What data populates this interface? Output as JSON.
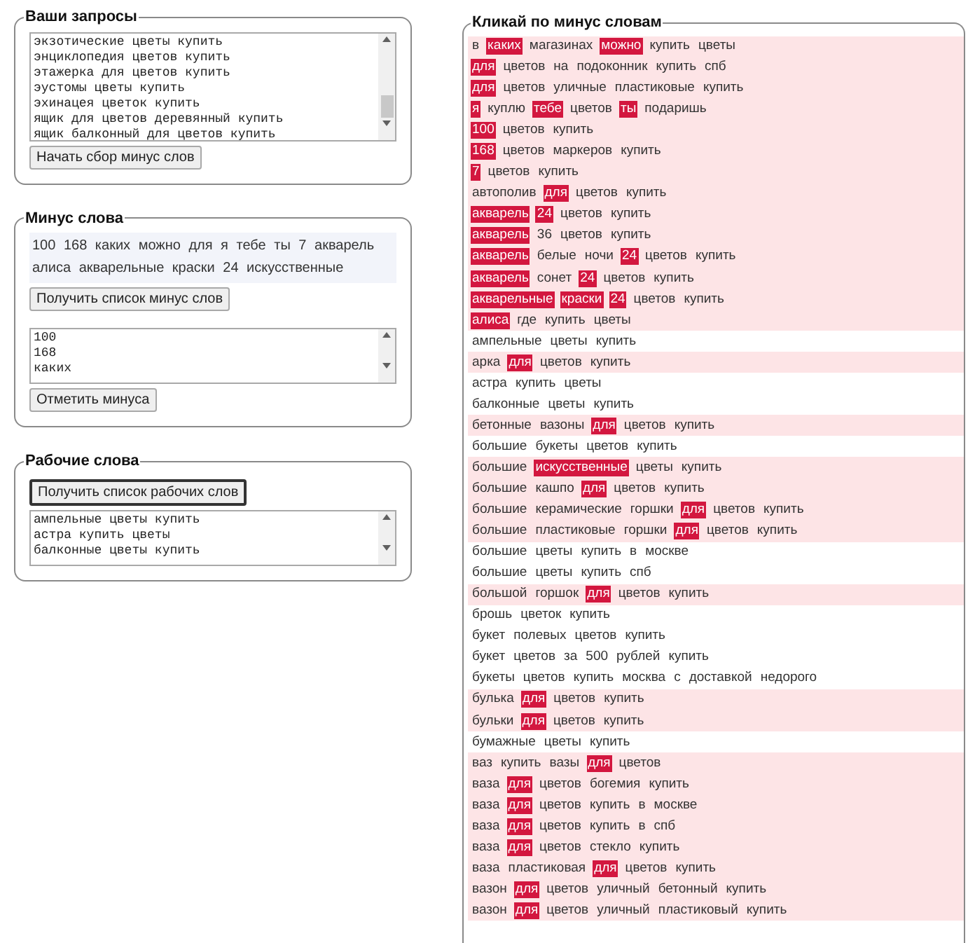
{
  "queries": {
    "title": "Ваши запросы",
    "lines": [
      "экзотические цветы купить",
      "энциклопедия цветов купить",
      "этажерка для цветов купить",
      "эустомы цветы купить",
      "эхинацея цветок купить",
      "ящик для цветов деревянный купить",
      "ящик балконный для цветов купить"
    ],
    "button": "Начать сбор минус слов"
  },
  "minus": {
    "title": "Минус слова",
    "summary": "100 168 каких можно для я тебе ты 7 акварель алиса акварельные краски 24 искусственные",
    "get_button": "Получить список минус слов",
    "lines": [
      "100",
      "168",
      "каких"
    ],
    "mark_button": "Отметить минуса"
  },
  "working": {
    "title": "Рабочие слова",
    "button": "Получить список рабочих слов",
    "lines": [
      "ампельные цветы купить",
      "астра купить цветы",
      "балконные цветы купить"
    ]
  },
  "results": {
    "title": "Кликай по минус словам",
    "rows": [
      {
        "words": [
          {
            "text": "в",
            "minus": false
          },
          {
            "text": "каких",
            "minus": true
          },
          {
            "text": "магазинах",
            "minus": false
          },
          {
            "text": "можно",
            "minus": true
          },
          {
            "text": "купить",
            "minus": false
          },
          {
            "text": "цветы",
            "minus": false
          }
        ]
      },
      {
        "words": [
          {
            "text": "для",
            "minus": true
          },
          {
            "text": "цветов",
            "minus": false
          },
          {
            "text": "на",
            "minus": false
          },
          {
            "text": "подоконник",
            "minus": false
          },
          {
            "text": "купить",
            "minus": false
          },
          {
            "text": "спб",
            "minus": false
          }
        ]
      },
      {
        "words": [
          {
            "text": "для",
            "minus": true
          },
          {
            "text": "цветов",
            "minus": false
          },
          {
            "text": "уличные",
            "minus": false
          },
          {
            "text": "пластиковые",
            "minus": false
          },
          {
            "text": "купить",
            "minus": false
          }
        ]
      },
      {
        "words": [
          {
            "text": "я",
            "minus": true
          },
          {
            "text": "куплю",
            "minus": false
          },
          {
            "text": "тебе",
            "minus": true
          },
          {
            "text": "цветов",
            "minus": false
          },
          {
            "text": "ты",
            "minus": true
          },
          {
            "text": "подаришь",
            "minus": false
          }
        ]
      },
      {
        "words": [
          {
            "text": "100",
            "minus": true
          },
          {
            "text": "цветов",
            "minus": false
          },
          {
            "text": "купить",
            "minus": false
          }
        ]
      },
      {
        "words": [
          {
            "text": "168",
            "minus": true
          },
          {
            "text": "цветов",
            "minus": false
          },
          {
            "text": "маркеров",
            "minus": false
          },
          {
            "text": "купить",
            "minus": false
          }
        ]
      },
      {
        "words": [
          {
            "text": "7",
            "minus": true
          },
          {
            "text": "цветов",
            "minus": false
          },
          {
            "text": "купить",
            "minus": false
          }
        ]
      },
      {
        "words": [
          {
            "text": "автополив",
            "minus": false
          },
          {
            "text": "для",
            "minus": true
          },
          {
            "text": "цветов",
            "minus": false
          },
          {
            "text": "купить",
            "minus": false
          }
        ]
      },
      {
        "words": [
          {
            "text": "акварель",
            "minus": true
          },
          {
            "text": "24",
            "minus": true
          },
          {
            "text": "цветов",
            "minus": false
          },
          {
            "text": "купить",
            "minus": false
          }
        ]
      },
      {
        "words": [
          {
            "text": "акварель",
            "minus": true
          },
          {
            "text": "36",
            "minus": false
          },
          {
            "text": "цветов",
            "minus": false
          },
          {
            "text": "купить",
            "minus": false
          }
        ]
      },
      {
        "words": [
          {
            "text": "акварель",
            "minus": true
          },
          {
            "text": "белые",
            "minus": false
          },
          {
            "text": "ночи",
            "minus": false
          },
          {
            "text": "24",
            "minus": true
          },
          {
            "text": "цветов",
            "minus": false
          },
          {
            "text": "купить",
            "minus": false
          }
        ]
      },
      {
        "words": [
          {
            "text": "акварель",
            "minus": true
          },
          {
            "text": "сонет",
            "minus": false
          },
          {
            "text": "24",
            "minus": true
          },
          {
            "text": "цветов",
            "minus": false
          },
          {
            "text": "купить",
            "minus": false
          }
        ]
      },
      {
        "words": [
          {
            "text": "акварельные",
            "minus": true
          },
          {
            "text": "краски",
            "minus": true
          },
          {
            "text": "24",
            "minus": true
          },
          {
            "text": "цветов",
            "minus": false
          },
          {
            "text": "купить",
            "minus": false
          }
        ]
      },
      {
        "words": [
          {
            "text": "алиса",
            "minus": true
          },
          {
            "text": "где",
            "minus": false
          },
          {
            "text": "купить",
            "minus": false
          },
          {
            "text": "цветы",
            "minus": false
          }
        ]
      },
      {
        "words": [
          {
            "text": "ампельные",
            "minus": false
          },
          {
            "text": "цветы",
            "minus": false
          },
          {
            "text": "купить",
            "minus": false
          }
        ]
      },
      {
        "words": [
          {
            "text": "арка",
            "minus": false
          },
          {
            "text": "для",
            "minus": true
          },
          {
            "text": "цветов",
            "minus": false
          },
          {
            "text": "купить",
            "minus": false
          }
        ]
      },
      {
        "words": [
          {
            "text": "астра",
            "minus": false
          },
          {
            "text": "купить",
            "minus": false
          },
          {
            "text": "цветы",
            "minus": false
          }
        ]
      },
      {
        "words": [
          {
            "text": "балконные",
            "minus": false
          },
          {
            "text": "цветы",
            "minus": false
          },
          {
            "text": "купить",
            "minus": false
          }
        ]
      },
      {
        "words": [
          {
            "text": "бетонные",
            "minus": false
          },
          {
            "text": "вазоны",
            "minus": false
          },
          {
            "text": "для",
            "minus": true
          },
          {
            "text": "цветов",
            "minus": false
          },
          {
            "text": "купить",
            "minus": false
          }
        ]
      },
      {
        "words": [
          {
            "text": "большие",
            "minus": false
          },
          {
            "text": "букеты",
            "minus": false
          },
          {
            "text": "цветов",
            "minus": false
          },
          {
            "text": "купить",
            "minus": false
          }
        ]
      },
      {
        "words": [
          {
            "text": "большие",
            "minus": false
          },
          {
            "text": "искусственные",
            "minus": true
          },
          {
            "text": "цветы",
            "minus": false
          },
          {
            "text": "купить",
            "minus": false
          }
        ]
      },
      {
        "words": [
          {
            "text": "большие",
            "minus": false
          },
          {
            "text": "кашпо",
            "minus": false
          },
          {
            "text": "для",
            "minus": true
          },
          {
            "text": "цветов",
            "minus": false
          },
          {
            "text": "купить",
            "minus": false
          }
        ]
      },
      {
        "words": [
          {
            "text": "большие",
            "minus": false
          },
          {
            "text": "керамические",
            "minus": false
          },
          {
            "text": "горшки",
            "minus": false
          },
          {
            "text": "для",
            "minus": true
          },
          {
            "text": "цветов",
            "minus": false
          },
          {
            "text": "купить",
            "minus": false
          }
        ]
      },
      {
        "words": [
          {
            "text": "большие",
            "minus": false
          },
          {
            "text": "пластиковые",
            "minus": false
          },
          {
            "text": "горшки",
            "minus": false
          },
          {
            "text": "для",
            "minus": true
          },
          {
            "text": "цветов",
            "minus": false
          },
          {
            "text": "купить",
            "minus": false
          }
        ]
      },
      {
        "words": [
          {
            "text": "большие",
            "minus": false
          },
          {
            "text": "цветы",
            "minus": false
          },
          {
            "text": "купить",
            "minus": false
          },
          {
            "text": "в",
            "minus": false
          },
          {
            "text": "москве",
            "minus": false
          }
        ]
      },
      {
        "words": [
          {
            "text": "большие",
            "minus": false
          },
          {
            "text": "цветы",
            "minus": false
          },
          {
            "text": "купить",
            "minus": false
          },
          {
            "text": "спб",
            "minus": false
          }
        ]
      },
      {
        "words": [
          {
            "text": "большой",
            "minus": false
          },
          {
            "text": "горшок",
            "minus": false
          },
          {
            "text": "для",
            "minus": true
          },
          {
            "text": "цветов",
            "minus": false
          },
          {
            "text": "купить",
            "minus": false
          }
        ]
      },
      {
        "words": [
          {
            "text": "брошь",
            "minus": false
          },
          {
            "text": "цветок",
            "minus": false
          },
          {
            "text": "купить",
            "minus": false
          }
        ]
      },
      {
        "words": [
          {
            "text": "букет",
            "minus": false
          },
          {
            "text": "полевых",
            "minus": false
          },
          {
            "text": "цветов",
            "minus": false
          },
          {
            "text": "купить",
            "minus": false
          }
        ]
      },
      {
        "words": [
          {
            "text": "букет",
            "minus": false
          },
          {
            "text": "цветов",
            "minus": false
          },
          {
            "text": "за",
            "minus": false
          },
          {
            "text": "500",
            "minus": false
          },
          {
            "text": "рублей",
            "minus": false
          },
          {
            "text": "купить",
            "minus": false
          }
        ]
      },
      {
        "words": [
          {
            "text": "букеты",
            "minus": false
          },
          {
            "text": "цветов",
            "minus": false
          },
          {
            "text": "купить",
            "minus": false
          },
          {
            "text": "москва",
            "minus": false
          },
          {
            "text": "с",
            "minus": false
          },
          {
            "text": "доставкой",
            "minus": false
          },
          {
            "text": "недорого",
            "minus": false
          }
        ]
      },
      {
        "words": [
          {
            "text": "булька",
            "minus": false
          },
          {
            "text": "для",
            "minus": true
          },
          {
            "text": "цветов",
            "minus": false
          },
          {
            "text": "купить",
            "minus": false
          }
        ]
      },
      {
        "words": [
          {
            "text": "бульки",
            "minus": false
          },
          {
            "text": "для",
            "minus": true
          },
          {
            "text": "цветов",
            "minus": false
          },
          {
            "text": "купить",
            "minus": false
          }
        ]
      },
      {
        "words": [
          {
            "text": "бумажные",
            "minus": false
          },
          {
            "text": "цветы",
            "minus": false
          },
          {
            "text": "купить",
            "minus": false
          }
        ]
      },
      {
        "words": [
          {
            "text": "ваз",
            "minus": false
          },
          {
            "text": "купить",
            "minus": false
          },
          {
            "text": "вазы",
            "minus": false
          },
          {
            "text": "для",
            "minus": true
          },
          {
            "text": "цветов",
            "minus": false
          }
        ]
      },
      {
        "words": [
          {
            "text": "ваза",
            "minus": false
          },
          {
            "text": "для",
            "minus": true
          },
          {
            "text": "цветов",
            "minus": false
          },
          {
            "text": "богемия",
            "minus": false
          },
          {
            "text": "купить",
            "minus": false
          }
        ]
      },
      {
        "words": [
          {
            "text": "ваза",
            "minus": false
          },
          {
            "text": "для",
            "minus": true
          },
          {
            "text": "цветов",
            "minus": false
          },
          {
            "text": "купить",
            "minus": false
          },
          {
            "text": "в",
            "minus": false
          },
          {
            "text": "москве",
            "minus": false
          }
        ]
      },
      {
        "words": [
          {
            "text": "ваза",
            "minus": false
          },
          {
            "text": "для",
            "minus": true
          },
          {
            "text": "цветов",
            "minus": false
          },
          {
            "text": "купить",
            "minus": false
          },
          {
            "text": "в",
            "minus": false
          },
          {
            "text": "спб",
            "minus": false
          }
        ]
      },
      {
        "words": [
          {
            "text": "ваза",
            "minus": false
          },
          {
            "text": "для",
            "minus": true
          },
          {
            "text": "цветов",
            "minus": false
          },
          {
            "text": "стекло",
            "minus": false
          },
          {
            "text": "купить",
            "minus": false
          }
        ]
      },
      {
        "words": [
          {
            "text": "ваза",
            "minus": false
          },
          {
            "text": "пластиковая",
            "minus": false
          },
          {
            "text": "для",
            "minus": true
          },
          {
            "text": "цветов",
            "minus": false
          },
          {
            "text": "купить",
            "minus": false
          }
        ]
      },
      {
        "words": [
          {
            "text": "вазон",
            "minus": false
          },
          {
            "text": "для",
            "minus": true
          },
          {
            "text": "цветов",
            "minus": false
          },
          {
            "text": "уличный",
            "minus": false
          },
          {
            "text": "бетонный",
            "minus": false
          },
          {
            "text": "купить",
            "minus": false
          }
        ]
      },
      {
        "words": [
          {
            "text": "вазон",
            "minus": false
          },
          {
            "text": "для",
            "minus": true
          },
          {
            "text": "цветов",
            "minus": false
          },
          {
            "text": "уличный",
            "minus": false
          },
          {
            "text": "пластиковый",
            "minus": false
          },
          {
            "text": "купить",
            "minus": false
          }
        ]
      }
    ]
  }
}
